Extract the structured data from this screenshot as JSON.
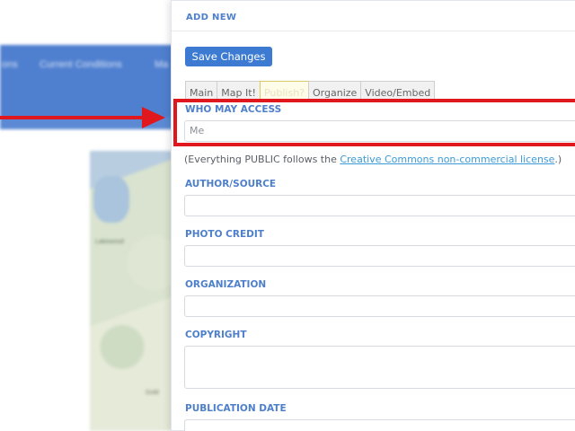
{
  "background": {
    "nav_items": [
      "ons",
      "Current Conditions",
      "Ma"
    ],
    "map_labels": [
      "Lakewood",
      "Gold"
    ]
  },
  "panel": {
    "title": "ADD NEW",
    "save_label": "Save Changes",
    "tabs": [
      {
        "label": "Main",
        "active": false
      },
      {
        "label": "Map It!",
        "active": false
      },
      {
        "label": "Publish?",
        "active": true
      },
      {
        "label": "Organize",
        "active": false
      },
      {
        "label": "Video/Embed",
        "active": false
      }
    ],
    "access": {
      "label": "WHO MAY ACCESS",
      "value": "Me"
    },
    "license": {
      "prefix": "(Everything PUBLIC follows the ",
      "link": "Creative Commons non-commercial license",
      "suffix": ".)"
    },
    "author": {
      "label": "AUTHOR/SOURCE",
      "value": ""
    },
    "photo_credit": {
      "label": "PHOTO CREDIT",
      "value": ""
    },
    "organization": {
      "label": "ORGANIZATION",
      "value": ""
    },
    "copyright": {
      "label": "COPYRIGHT",
      "value": ""
    },
    "publication_date": {
      "label": "PUBLICATION DATE",
      "value": ""
    }
  },
  "annotation": {
    "color": "#e0171d"
  },
  "colors": {
    "accent": "#3c7bd1",
    "label": "#4d7fca",
    "link": "#3b9ad8"
  }
}
